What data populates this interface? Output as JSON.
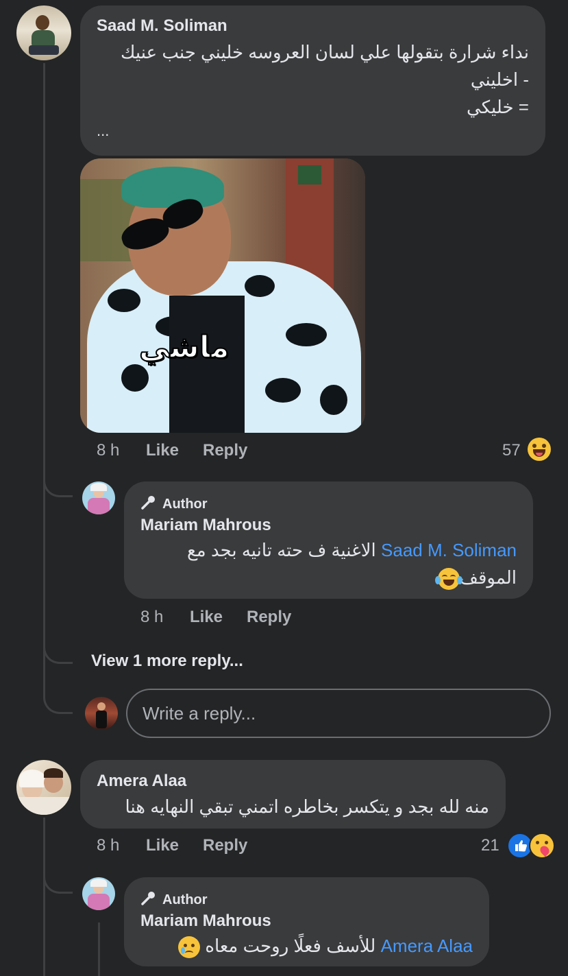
{
  "comments": [
    {
      "author": "Saad M. Soliman",
      "lines": [
        "نداء شرارة بتقولها علي لسان العروسه خليني جنب عنيك",
        "- اخليني",
        "= خليكي",
        "..."
      ],
      "image_caption": "ماشي",
      "time": "8 h",
      "like": "Like",
      "reply": "Reply",
      "reaction_count": "57",
      "reaction_icon": "laughing-emoji"
    },
    {
      "author": "Amera Alaa",
      "text": "منه لله بجد و يتكسر بخاطره اتمني تبقي النهايه هنا",
      "time": "8 h",
      "like": "Like",
      "reply": "Reply",
      "reaction_count": "21",
      "reaction_icons": [
        "like-icon",
        "care-icon"
      ]
    }
  ],
  "replies": [
    {
      "badge": "Author",
      "author": "Mariam Mahrous",
      "mention": "Saad M. Soliman",
      "text_line1": "الاغنية ف حته تانيه بجد مع",
      "text_line2": "الموقف",
      "emoji": "tears-of-joy",
      "time": "8 h",
      "like": "Like",
      "reply": "Reply"
    },
    {
      "badge": "Author",
      "author": "Mariam Mahrous",
      "mention": "Amera Alaa",
      "text": "للأسف فعلًا روحت معاه",
      "emoji": "crying-face"
    }
  ],
  "view_more": "View 1 more reply...",
  "reply_placeholder": "Write a reply...",
  "colors": {
    "background": "#242526",
    "bubble": "#3a3b3c",
    "link": "#4599ff",
    "meta": "#b0b3b8"
  }
}
